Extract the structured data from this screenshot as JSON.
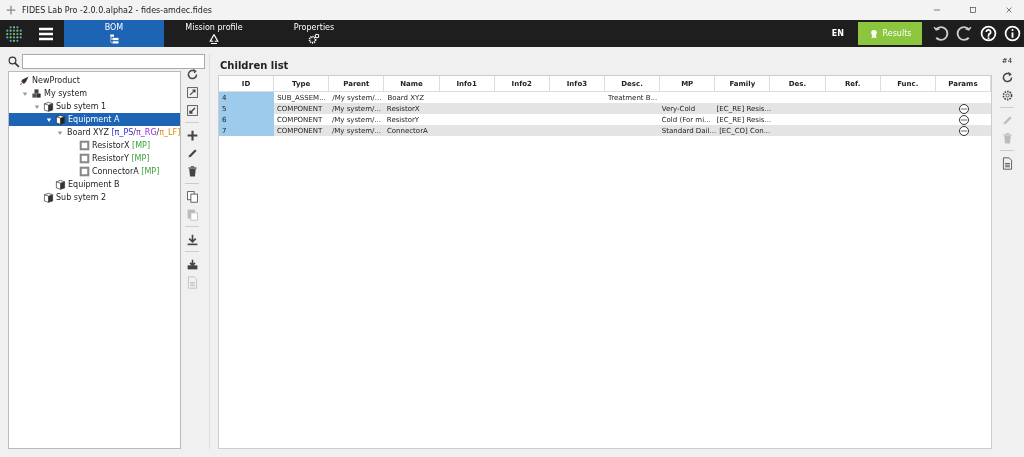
{
  "window": {
    "title": "FIDES Lab Pro -2.0.0.alpha2 - fides-amdec.fides"
  },
  "nav_tabs": [
    {
      "label": "BOM",
      "kind": "list",
      "selected": true
    },
    {
      "label": "Mission profile",
      "kind": "recycle",
      "selected": false
    },
    {
      "label": "Properties",
      "kind": "gears",
      "selected": false
    }
  ],
  "language": "EN",
  "results_button": "Results",
  "tree": {
    "items": [
      {
        "label": "NewProduct",
        "kind": "product",
        "selected": false,
        "children": [
          {
            "label": "My system",
            "kind": "system",
            "selected": false,
            "expanded": true,
            "children": [
              {
                "label": "Sub sytem 1",
                "kind": "assembly",
                "selected": false,
                "expanded": true,
                "children": [
                  {
                    "label": "Equipment A",
                    "kind": "assembly",
                    "selected": true,
                    "expanded": true,
                    "children": [
                      {
                        "label": "Board XYZ",
                        "kind": "board",
                        "selected": false,
                        "expanded": true,
                        "tag_parts": [
                          {
                            "text": "[π_PS",
                            "kind": "ps"
                          },
                          {
                            "text": "/",
                            "kind": "separator"
                          },
                          {
                            "text": "π_RG",
                            "kind": "rg"
                          },
                          {
                            "text": "/",
                            "kind": "separator"
                          },
                          {
                            "text": "π_LF]",
                            "kind": "lf"
                          }
                        ],
                        "children": [
                          {
                            "label": "ResistorX",
                            "kind": "component",
                            "selected": false,
                            "tag_parts": [
                              {
                                "text": "[MP]",
                                "kind": "mp"
                              }
                            ]
                          },
                          {
                            "label": "ResistorY",
                            "kind": "component",
                            "selected": false,
                            "tag_parts": [
                              {
                                "text": "[MP]",
                                "kind": "mp"
                              }
                            ]
                          },
                          {
                            "label": "ConnectorA",
                            "kind": "component",
                            "selected": false,
                            "tag_parts": [
                              {
                                "text": "[MP]",
                                "kind": "mp"
                              }
                            ]
                          }
                        ]
                      }
                    ]
                  },
                  {
                    "label": "Equipment B",
                    "kind": "assembly",
                    "selected": false
                  }
                ]
              },
              {
                "label": "Sub sytem 2",
                "kind": "assembly",
                "selected": false
              }
            ]
          }
        ]
      }
    ]
  },
  "tree_toolbar": [
    {
      "kind": "refresh",
      "disabled": false
    },
    {
      "kind": "expand",
      "disabled": false
    },
    {
      "kind": "collapse",
      "disabled": false
    },
    {
      "kind": "separator"
    },
    {
      "kind": "add",
      "disabled": false
    },
    {
      "kind": "edit",
      "disabled": false
    },
    {
      "kind": "delete",
      "disabled": false
    },
    {
      "kind": "separator"
    },
    {
      "kind": "copy",
      "disabled": false
    },
    {
      "kind": "paste",
      "disabled": true
    },
    {
      "kind": "separator"
    },
    {
      "kind": "download",
      "disabled": false
    },
    {
      "kind": "separator"
    },
    {
      "kind": "import",
      "disabled": false
    },
    {
      "kind": "document",
      "disabled": true
    }
  ],
  "children_list": {
    "title": "Children list",
    "columns": [
      "ID",
      "Type",
      "Parent",
      "Name",
      "Info1",
      "Info2",
      "Info3",
      "Desc.",
      "MP",
      "Family",
      "Des.",
      "Ref.",
      "Func.",
      "Params"
    ],
    "rows": [
      {
        "cells": [
          "4",
          "SUB_ASSEM...",
          "/My system/...",
          "Board XYZ",
          "",
          "",
          "",
          "Treatment B...",
          "",
          "",
          "",
          "",
          ""
        ],
        "params_button": false
      },
      {
        "cells": [
          "5",
          "COMPONENT",
          "/My system/...",
          "ResistorX",
          "",
          "",
          "",
          "",
          "Very-Cold",
          "[EC_RE] Resis...",
          "",
          "",
          ""
        ],
        "params_button": true
      },
      {
        "cells": [
          "6",
          "COMPONENT",
          "/My system/...",
          "ResistorY",
          "",
          "",
          "",
          "",
          "Cold (For mi...",
          "[EC_RE] Resis...",
          "",
          "",
          ""
        ],
        "params_button": true
      },
      {
        "cells": [
          "7",
          "COMPONENT",
          "/My system/...",
          "ConnectorA",
          "",
          "",
          "",
          "",
          "Standard Dail...",
          "[EC_CO] Con...",
          "",
          "",
          ""
        ],
        "params_button": true
      }
    ]
  },
  "side_toolbar": {
    "count": "#4",
    "tools": [
      {
        "kind": "refresh",
        "disabled": false
      },
      {
        "kind": "settings",
        "disabled": false
      },
      {
        "kind": "separator"
      },
      {
        "kind": "edit",
        "disabled": true
      },
      {
        "kind": "delete",
        "disabled": true
      },
      {
        "kind": "separator"
      },
      {
        "kind": "document",
        "disabled": false
      }
    ]
  }
}
